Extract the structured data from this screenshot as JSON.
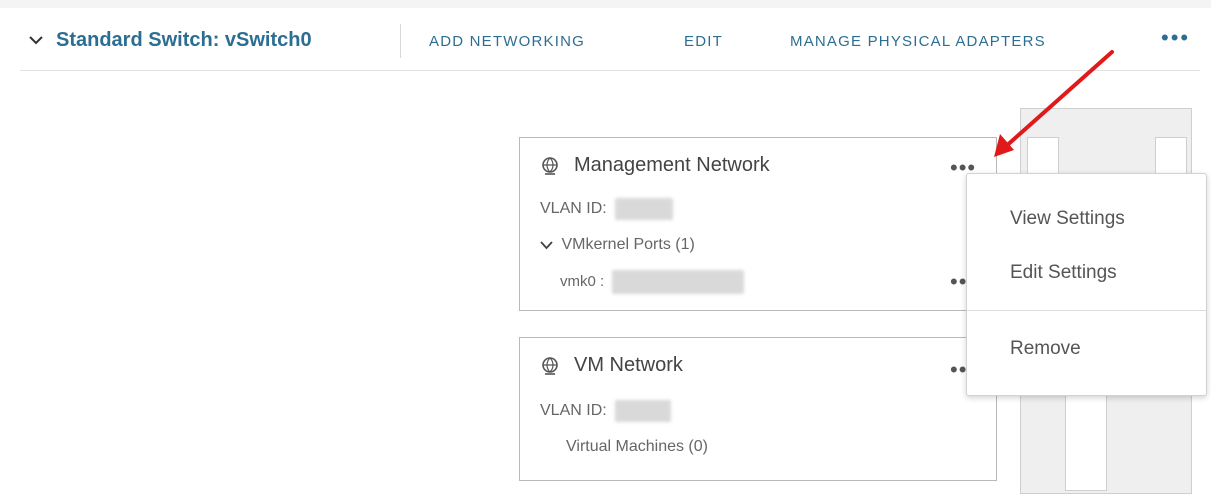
{
  "header": {
    "title": "Standard Switch: vSwitch0",
    "actions": {
      "add_networking": "ADD NETWORKING",
      "edit": "EDIT",
      "manage_adapters": "MANAGE PHYSICAL ADAPTERS",
      "more": "•••"
    }
  },
  "portgroups": [
    {
      "name": "Management Network",
      "vlan_label": "VLAN ID:",
      "ports_label": "VMkernel Ports (1)",
      "port_item": "vmk0 :",
      "more": "•••"
    },
    {
      "name": "VM Network",
      "vlan_label": "VLAN ID:",
      "vms_label": "Virtual Machines (0)",
      "more": "•••"
    }
  ],
  "menu": {
    "items": [
      "View Settings",
      "Edit Settings",
      "Remove"
    ]
  },
  "colors": {
    "link": "#2c6e92",
    "annotation_arrow": "#e0191b"
  }
}
